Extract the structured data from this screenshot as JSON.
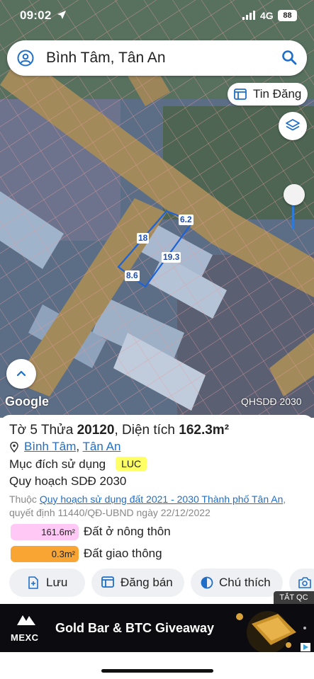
{
  "status_bar": {
    "time": "09:02",
    "network": "4G",
    "battery": "88"
  },
  "search": {
    "query": "Bình Tâm, Tân An"
  },
  "map": {
    "tin_dang_label": "Tin Đăng",
    "dimensions": [
      "6.2",
      "18",
      "19.3",
      "8.6"
    ],
    "attribution": "Google",
    "overlay_label": "QHSDĐ 2030"
  },
  "parcel": {
    "title_prefix": "Tờ 5 Thửa ",
    "parcel_no": "20120",
    "title_mid": ", Diện tích ",
    "area": "162.3m²",
    "ward": "Bình Tâm",
    "sep": ",",
    "city": "Tân An",
    "purpose_label": "Mục đích sử dụng",
    "purpose_code": "LUC",
    "plan_label": "Quy hoạch SDĐ 2030",
    "desc_prefix": "Thuộc ",
    "desc_link": "Quy hoạch sử dụng đất 2021 - 2030 Thành phố Tân An",
    "desc_suffix": ", quyết định 11440/QĐ-UBND ngày 22/12/2022",
    "legend": [
      {
        "value": "161.6m²",
        "label": "Đất ở nông thôn",
        "color": "#ffc8f5"
      },
      {
        "value": "0.3m²",
        "label": "Đất giao thông",
        "color": "#f9a533"
      }
    ]
  },
  "actions": {
    "save": "Lưu",
    "post": "Đăng bán",
    "legend": "Chú thích"
  },
  "ad": {
    "close_label": "TẮT QC",
    "brand": "MEXC",
    "headline": "Gold Bar & BTC Giveaway"
  }
}
